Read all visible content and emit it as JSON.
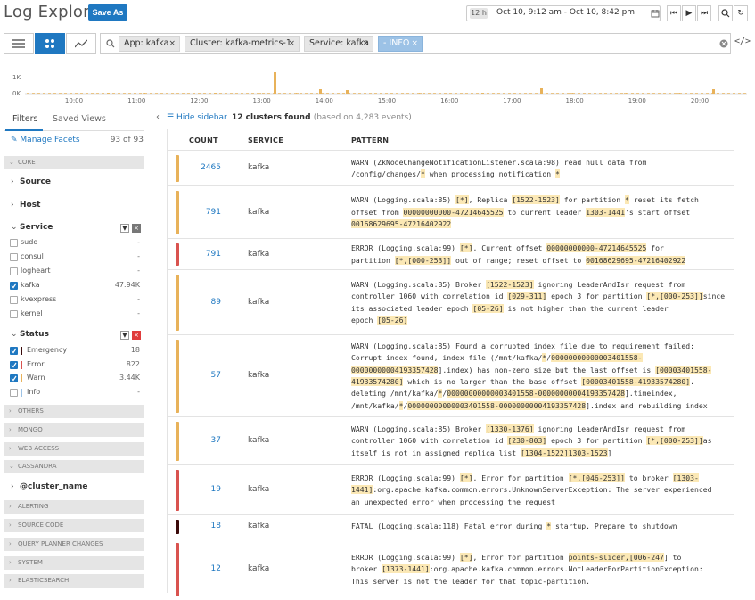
{
  "header": {
    "title": "Log Explorer",
    "save_label": "Save As",
    "range_badge": "12 h",
    "time_range": "Oct 10, 9:12 am - Oct 10, 8:42 pm"
  },
  "search": {
    "chips": [
      "App: kafka",
      "Cluster: kafka-metrics-1",
      "Service: kafka",
      "- INFO"
    ]
  },
  "histogram": {
    "y_labels": [
      "1K",
      "0K"
    ],
    "x_labels": [
      "10:00",
      "11:00",
      "12:00",
      "13:00",
      "14:00",
      "15:00",
      "16:00",
      "17:00",
      "18:00",
      "19:00",
      "20:00"
    ],
    "bar_color": "#e8b25a"
  },
  "sidebar": {
    "tabs": [
      "Filters",
      "Saved Views"
    ],
    "manage_label": "Manage Facets",
    "manage_count": "93 of 93",
    "sections": {
      "core": "CORE",
      "others": "OTHERS",
      "mongo": "MONGO",
      "web_access": "WEB ACCESS",
      "cassandra": "CASSANDRA",
      "alerting": "ALERTING",
      "source_code": "SOURCE CODE",
      "query_planner": "QUERY PLANNER CHANGES",
      "system": "SYSTEM",
      "elasticsearch": "ELASTICSEARCH"
    },
    "facets": {
      "source": "Source",
      "host": "Host",
      "service": "Service",
      "status": "Status",
      "cluster_name": "@cluster_name"
    },
    "service_values": [
      {
        "label": "sudo",
        "count": "-",
        "checked": false
      },
      {
        "label": "consul",
        "count": "-",
        "checked": false
      },
      {
        "label": "logheart",
        "count": "-",
        "checked": false
      },
      {
        "label": "kafka",
        "count": "47.94K",
        "checked": true
      },
      {
        "label": "kvexpress",
        "count": "-",
        "checked": false
      },
      {
        "label": "kernel",
        "count": "-",
        "checked": false
      }
    ],
    "status_values": [
      {
        "label": "Emergency",
        "count": "18",
        "checked": true,
        "color": "#3b0a0a"
      },
      {
        "label": "Error",
        "count": "822",
        "checked": true,
        "color": "#d9534f"
      },
      {
        "label": "Warn",
        "count": "3.44K",
        "checked": true,
        "color": "#e8b25a"
      },
      {
        "label": "Info",
        "count": "-",
        "checked": false,
        "color": "#9cc2e6"
      }
    ]
  },
  "main": {
    "hide_sidebar": "Hide sidebar",
    "clusters_found": "12 clusters found",
    "clusters_sub": "(based on 4,283 events)",
    "columns": {
      "count": "COUNT",
      "service": "SERVICE",
      "pattern": "PATTERN"
    },
    "rows": [
      {
        "count": "2465",
        "service": "kafka",
        "level": "warn",
        "pattern": "WARN (ZkNodeChangeNotificationListener.scala:98) read null data from\n/config/changes/[*] when processing notification [*]"
      },
      {
        "count": "791",
        "service": "kafka",
        "level": "warn",
        "pattern": "WARN (Logging.scala:85) [[*]], Replica [[1522-1523]] for partition [*] reset its fetch\noffset from [00000000000-47214645525] to current leader [1303-1441]'s start offset\n[00168629695-47216402922]"
      },
      {
        "count": "791",
        "service": "kafka",
        "level": "error",
        "pattern": "ERROR (Logging.scala:99) [[*]], Current offset [00000000000-47214645525] for\npartition [[*,[000-253]]] out of range; reset offset to [00168629695-47216402922]"
      },
      {
        "count": "89",
        "service": "kafka",
        "level": "warn",
        "pattern": "WARN (Logging.scala:85) Broker [[1522-1523]] ignoring LeaderAndIsr request from\ncontroller 1060 with correlation id [[029-311]] epoch 3 for partition [[*,[000-253]]\nsince its associated leader epoch [[05-26]] is not higher than the current leader\nepoch [[05-26]]"
      },
      {
        "count": "57",
        "service": "kafka",
        "level": "warn",
        "pattern": "WARN (Logging.scala:85) Found a corrupted index file due to requirement failed:\nCorrupt index found, index file (/mnt/kafka/[*]/[00000000000003401558-\n00000000004193357428]].index) has non-zero size but the last offset is [[00003401558-\n41933574280]] which is no larger than the base offset [[00003401558-41933574280]].\ndeleting /mnt/kafka/[*]/[00000000000003401558-00000000004193357428]].timeindex,\n/mnt/kafka/[*]/[00000000000003401558-00000000004193357428]].index and rebuilding index"
      },
      {
        "count": "37",
        "service": "kafka",
        "level": "warn",
        "pattern": "WARN (Logging.scala:85) Broker [[1330-1376]] ignoring LeaderAndIsr request from\ncontroller 1060 with correlation id [[230-803]] epoch 3 for partition [[*,[000-253]]\nas itself is not in assigned replica list [[1304-1522],[1303-1523]]"
      },
      {
        "count": "19",
        "service": "kafka",
        "level": "error",
        "pattern": "ERROR (Logging.scala:99) [[*]], Error for partition [[*,[046-253]]] to broker [[1303-\n1441]]:org.apache.kafka.common.errors.UnknownServerException: The server experienced\nan unexpected error when processing the request"
      },
      {
        "count": "18",
        "service": "kafka",
        "level": "fatal",
        "pattern": "FATAL (Logging.scala:118) Fatal error during [*] startup. Prepare to shutdown"
      },
      {
        "count": "12",
        "service": "kafka",
        "level": "error",
        "pattern": "ERROR (Logging.scala:99) [[*]], Error for partition [points-slicer,[006-247]] to\nbroker [[1373-1441]]:org.apache.kafka.common.errors.NotLeaderForPartitionException:\nThis server is not the leader for that topic-partition."
      }
    ],
    "level_colors": {
      "warn": "#e8b25a",
      "error": "#d9534f",
      "fatal": "#3b0a0a"
    }
  }
}
